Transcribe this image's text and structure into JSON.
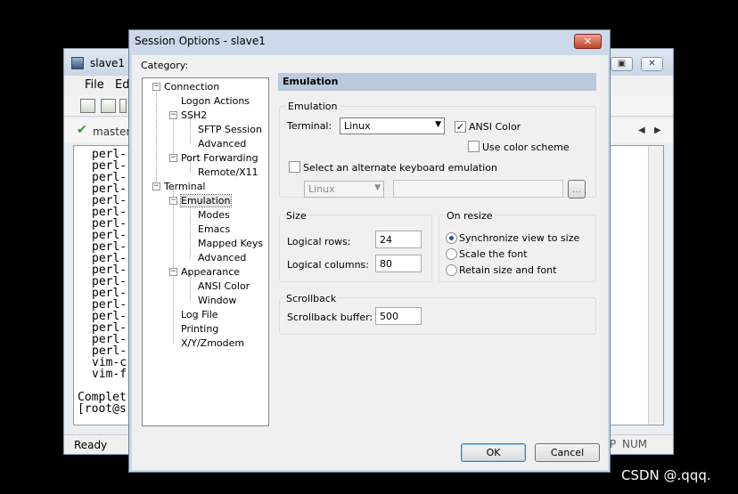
{
  "background_window": {
    "title": "slave1 -",
    "menu": [
      "File",
      "Ed"
    ],
    "tab_label": "master",
    "terminal_lines": [
      "perl-",
      "perl-",
      "perl-",
      "perl-",
      "perl-",
      "perl-",
      "perl-",
      "perl-",
      "perl-",
      "perl-",
      "perl-",
      "perl-",
      "perl-",
      "perl-",
      "perl-",
      "perl-",
      "perl-",
      "perl-",
      "vim-c",
      "vim-f"
    ],
    "terminal_tail": [
      "Complet",
      "[root@s"
    ],
    "status_text": "Ready",
    "status_cells": [
      "P",
      "NUM"
    ]
  },
  "dialog": {
    "title": "Session Options - slave1",
    "close_glyph": "✕",
    "category_label": "Category:",
    "tree": [
      {
        "label": "Connection",
        "toggle": "−"
      },
      {
        "label": "Logon Actions"
      },
      {
        "label": "SSH2",
        "toggle": "−"
      },
      {
        "label": "SFTP Session"
      },
      {
        "label": "Advanced"
      },
      {
        "label": "Port Forwarding",
        "toggle": "−"
      },
      {
        "label": "Remote/X11"
      },
      {
        "label": "Terminal",
        "toggle": "−"
      },
      {
        "label": "Emulation",
        "toggle": "−",
        "selected": true
      },
      {
        "label": "Modes"
      },
      {
        "label": "Emacs"
      },
      {
        "label": "Mapped Keys"
      },
      {
        "label": "Advanced"
      },
      {
        "label": "Appearance",
        "toggle": "−"
      },
      {
        "label": "ANSI Color"
      },
      {
        "label": "Window"
      },
      {
        "label": "Log File"
      },
      {
        "label": "Printing"
      },
      {
        "label": "X/Y/Zmodem"
      }
    ],
    "section_title": "Emulation",
    "emulation": {
      "group_label": "Emulation",
      "terminal_label": "Terminal:",
      "terminal_value": "Linux",
      "ansi_color_label": "ANSI Color",
      "ansi_color_checked": true,
      "use_color_scheme_label": "Use color scheme",
      "use_color_scheme_checked": false,
      "alt_keyboard_label": "Select an alternate keyboard emulation",
      "alt_keyboard_checked": false,
      "alt_keyboard_value": "Linux",
      "browse_label": "..."
    },
    "size": {
      "group_label": "Size",
      "rows_label": "Logical rows:",
      "rows_value": "24",
      "cols_label": "Logical columns:",
      "cols_value": "80"
    },
    "on_resize": {
      "group_label": "On resize",
      "options": [
        {
          "label": "Synchronize view to size",
          "selected": true
        },
        {
          "label": "Scale the font",
          "selected": false
        },
        {
          "label": "Retain size and font",
          "selected": false
        }
      ]
    },
    "scrollback": {
      "group_label": "Scrollback",
      "buffer_label": "Scrollback buffer:",
      "buffer_value": "500"
    },
    "ok_label": "OK",
    "cancel_label": "Cancel"
  },
  "watermark": "CSDN @.qqq.",
  "colors": {
    "selection_radio": "#1a56a8",
    "header_bg": "#bac9dc",
    "dialog_frame": "#cbd9ea"
  }
}
